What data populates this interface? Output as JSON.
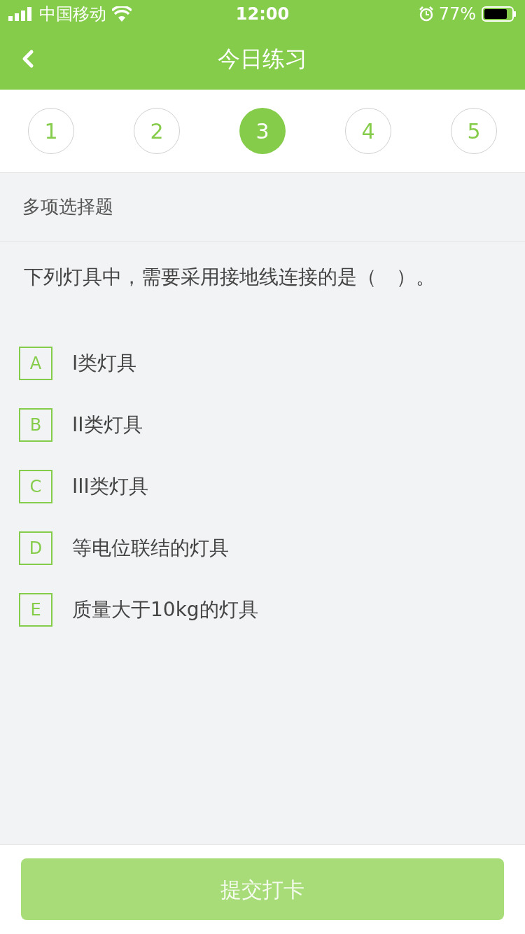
{
  "status_bar": {
    "carrier": "中国移动",
    "time": "12:00",
    "battery": "77%"
  },
  "nav": {
    "title": "今日练习"
  },
  "steps": [
    {
      "label": "1",
      "selected": false
    },
    {
      "label": "2",
      "selected": false
    },
    {
      "label": "3",
      "selected": true
    },
    {
      "label": "4",
      "selected": false
    },
    {
      "label": "5",
      "selected": false
    }
  ],
  "question": {
    "type": "多项选择题",
    "text": "下列灯具中，需要采用接地线连接的是（　）。",
    "options": [
      {
        "letter": "A",
        "text": "I类灯具",
        "selected": false
      },
      {
        "letter": "B",
        "text": "II类灯具",
        "selected": false
      },
      {
        "letter": "C",
        "text": "III类灯具",
        "selected": false
      },
      {
        "letter": "D",
        "text": "等电位联结的灯具",
        "selected": false
      },
      {
        "letter": "E",
        "text": "质量大于10kg的灯具",
        "selected": false
      }
    ]
  },
  "submit": {
    "label": "提交打卡",
    "disabled": true
  }
}
